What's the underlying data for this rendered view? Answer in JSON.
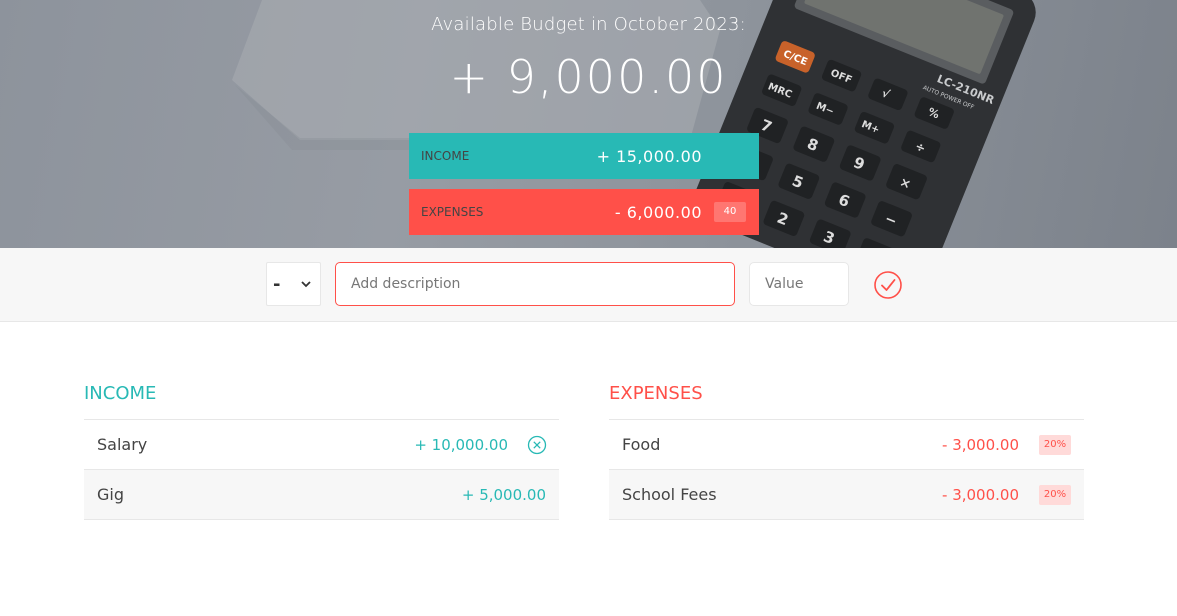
{
  "header": {
    "title": "Available Budget in October 2023:",
    "budget": "+ 9,000.00",
    "income": {
      "label": "Income",
      "value": "+ 15,000.00"
    },
    "expenses": {
      "label": "Expenses",
      "value": "- 6,000.00",
      "percentage": "40"
    }
  },
  "add_bar": {
    "type_selected": "-",
    "description_placeholder": "Add description",
    "value_placeholder": "Value",
    "submit_icon": "check-circle-icon"
  },
  "income_list": {
    "title": "Income",
    "items": [
      {
        "description": "Salary",
        "value": "+ 10,000.00"
      },
      {
        "description": "Gig",
        "value": "+ 5,000.00"
      }
    ]
  },
  "expenses_list": {
    "title": "Expenses",
    "items": [
      {
        "description": "Food",
        "value": "- 3,000.00",
        "percentage": "20%"
      },
      {
        "description": "School Fees",
        "value": "- 3,000.00",
        "percentage": "20%"
      }
    ]
  },
  "colors": {
    "income": "#28b9b5",
    "expenses": "#ff5049",
    "header_bg": "#8d939c"
  }
}
